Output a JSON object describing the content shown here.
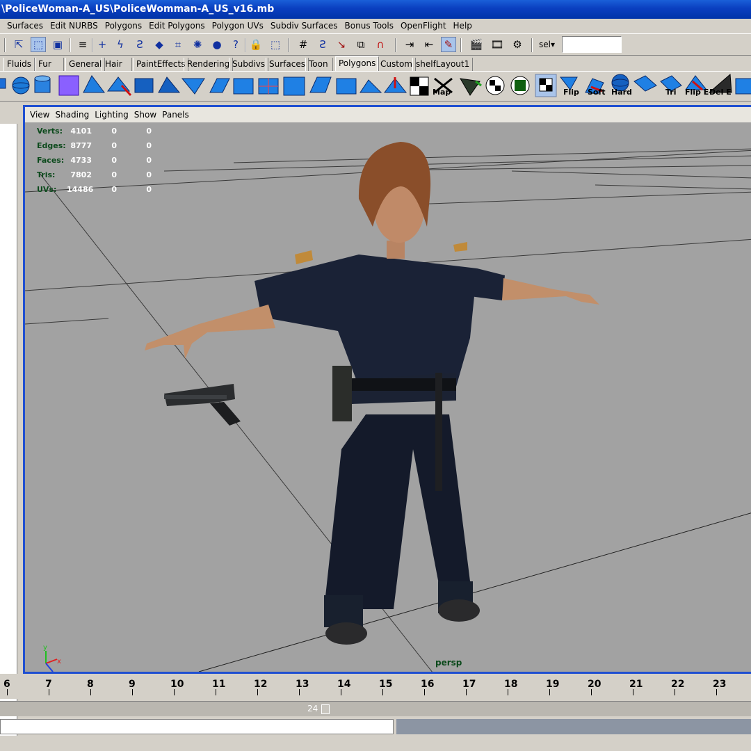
{
  "window": {
    "title": "\\PoliceWoman-A_US\\PoliceWomman-A_US_v16.mb"
  },
  "menubar": {
    "items": [
      "Surfaces",
      "Edit NURBS",
      "Polygons",
      "Edit Polygons",
      "Polygon UVs",
      "Subdiv Surfaces",
      "Bonus Tools",
      "OpenFlight",
      "Help"
    ]
  },
  "toolbar": {
    "sel_label": "sel▾",
    "sel_value": ""
  },
  "shelf": {
    "tabs": [
      "Fluids",
      "Fur",
      "General",
      "Hair",
      "PaintEffects",
      "Rendering",
      "Subdivs",
      "Surfaces",
      "Toon",
      "Polygons",
      "Custom",
      "shelfLayout1"
    ],
    "active_tab": "Polygons",
    "labels": [
      "Map",
      "Flip",
      "Soft",
      "Hard",
      "Tri",
      "Flip E",
      "Del E"
    ]
  },
  "viewport": {
    "menu": [
      "View",
      "Shading",
      "Lighting",
      "Show",
      "Panels"
    ],
    "camera": "persp",
    "hud": [
      {
        "label": "Verts:",
        "v1": "4101",
        "v2": "0",
        "v3": "0"
      },
      {
        "label": "Edges:",
        "v1": "8777",
        "v2": "0",
        "v3": "0"
      },
      {
        "label": "Faces:",
        "v1": "4733",
        "v2": "0",
        "v3": "0"
      },
      {
        "label": "Tris:",
        "v1": "7802",
        "v2": "0",
        "v3": "0"
      },
      {
        "label": "UVs:",
        "v1": "14486",
        "v2": "0",
        "v3": "0"
      }
    ]
  },
  "timeline": {
    "ticks": [
      "6",
      "7",
      "8",
      "9",
      "10",
      "11",
      "12",
      "13",
      "14",
      "15",
      "16",
      "17",
      "18",
      "19",
      "20",
      "21",
      "22",
      "23"
    ]
  },
  "range": {
    "end": "24"
  },
  "colors": {
    "title_blue": "#0a3fc0",
    "viewport_border": "#1f4fd1",
    "viewport_bg": "#a2a2a2",
    "hud_label": "#0c4a1c"
  }
}
